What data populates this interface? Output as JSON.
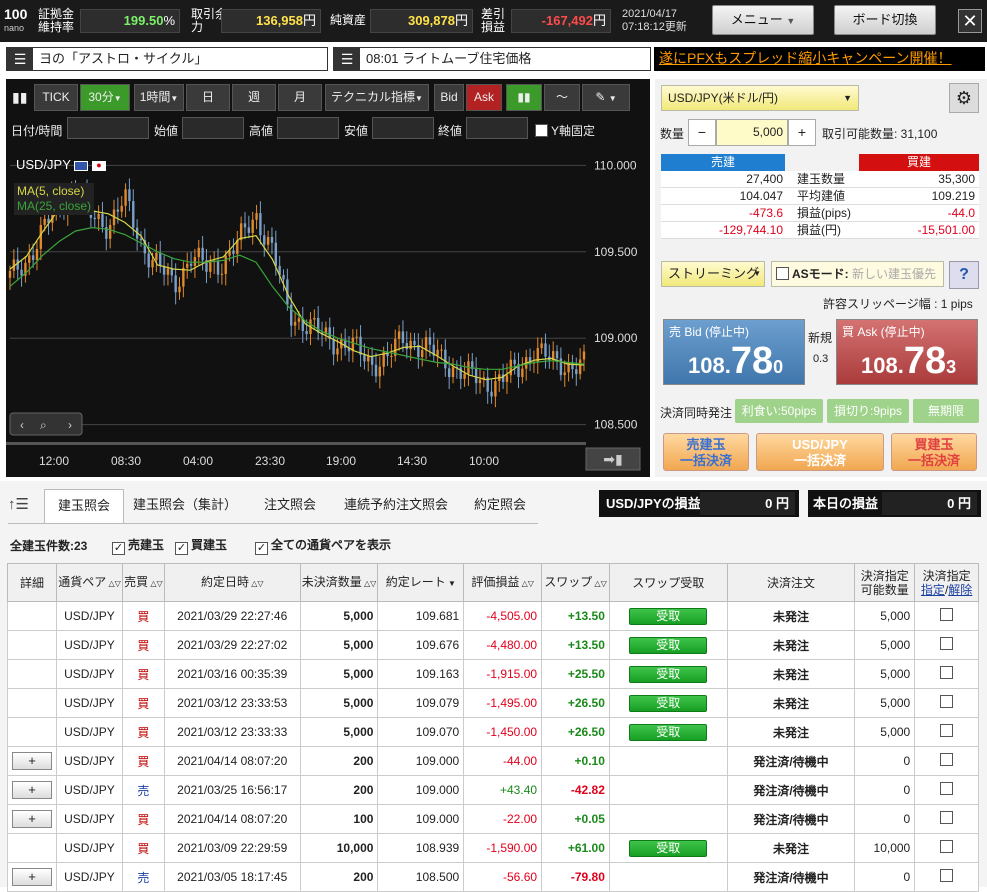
{
  "topbar": {
    "logo_main": "100",
    "logo_sub": "nano",
    "stats": [
      {
        "label": "証拠金維持率",
        "value": "199.50",
        "unit": "%"
      },
      {
        "label": "取引余力",
        "value": "136,958",
        "unit": "円"
      },
      {
        "label": "純資産",
        "value": "309,878",
        "unit": "円"
      },
      {
        "label": "差引損益",
        "value": "-167,492",
        "unit": "円"
      }
    ],
    "updated_date": "2021/04/17",
    "updated_time": "07:18:12更新",
    "menu_label": "メニュー",
    "board_label": "ボード切換",
    "close_label": "✕"
  },
  "news": {
    "item1": "ヨの「アストロ・サイクル」",
    "item2": "08:01 ライトムーブ住宅価格",
    "promo": "遂にPFXもスプレッド縮小キャンペーン開催！"
  },
  "chart_toolbar": {
    "tick": "TICK",
    "m30": "30分",
    "h1": "1時間",
    "day": "日",
    "week": "週",
    "month": "月",
    "tech": "テクニカル指標",
    "bid": "Bid",
    "ask": "Ask"
  },
  "chart_fields": {
    "datetime": "日付/時間",
    "open": "始値",
    "high": "高値",
    "low": "安値",
    "close": "終値",
    "yfix": "Y軸固定"
  },
  "chart_data": {
    "type": "line",
    "pair_label": "USD/JPY",
    "legend": [
      "MA(5, close)",
      "MA(25, close)"
    ],
    "y_ticks": [
      "110.000",
      "109.500",
      "109.000",
      "108.500"
    ],
    "ylim": [
      108.5,
      110.0
    ],
    "x_ticks": [
      "12:00",
      "08:30",
      "04:00",
      "23:30",
      "19:00",
      "14:30",
      "10:00"
    ],
    "price": [
      109.35,
      109.45,
      109.62,
      109.78,
      109.85,
      109.7,
      109.66,
      109.8,
      109.55,
      109.42,
      109.3,
      109.48,
      109.4,
      109.45,
      109.56,
      109.72,
      109.5,
      109.15,
      109.08,
      109.02,
      108.98,
      108.94,
      108.86,
      108.88,
      109.0,
      108.96,
      108.9,
      108.84,
      108.78,
      108.74,
      108.76,
      108.82,
      108.94,
      108.86,
      108.85,
      108.84
    ],
    "ma25": [
      109.3,
      109.38,
      109.48,
      109.56,
      109.62,
      109.64,
      109.63,
      109.6,
      109.55,
      109.5,
      109.46,
      109.44,
      109.44,
      109.45,
      109.48,
      109.44,
      109.3,
      109.18,
      109.1,
      109.04,
      109.0,
      108.97,
      108.94,
      108.92,
      108.9,
      108.88,
      108.86,
      108.85,
      108.83,
      108.82,
      108.82,
      108.84,
      108.86,
      108.87,
      108.86,
      108.85
    ]
  },
  "right": {
    "pair": "USD/JPY(米ドル/円)",
    "qty_label": "数量",
    "qty_value": "5,000",
    "minus": "−",
    "plus": "+",
    "available": "取引可能数量: 31,100",
    "sell_header": "売建",
    "buy_header": "買建",
    "rows": [
      {
        "sell": "27,400",
        "label": "建玉数量",
        "buy": "35,300"
      },
      {
        "sell": "104.047",
        "label": "平均建値",
        "buy": "109.219"
      },
      {
        "sell": "-473.6",
        "label": "損益(pips)",
        "buy": "-44.0"
      },
      {
        "sell": "-129,744.10",
        "label": "損益(円)",
        "buy": "-15,501.00"
      }
    ],
    "streaming": "ストリーミング",
    "as_mode": "ASモード:",
    "as_placeholder": "新しい建玉優先",
    "help": "?",
    "slippage": "許容スリッページ幅 : 1 pips",
    "bid_label": "売 Bid (停止中)",
    "bid_big": "108.",
    "bid_pips": "78",
    "bid_small": "0",
    "new_label": "新規",
    "spread": "0.3",
    "ask_label": "買 Ask (停止中)",
    "ask_big": "108.",
    "ask_pips": "78",
    "ask_small": "3",
    "settle_label": "決済同時発注",
    "take_profit": "利食い:50pips",
    "stop_loss": "損切り:9pips",
    "unlimited": "無期限",
    "btn1a": "売建玉",
    "btn1b": "一括決済",
    "btn2a": "USD/JPY",
    "btn2b": "一括決済",
    "btn3a": "買建玉",
    "btn3b": "一括決済"
  },
  "tabs": [
    "建玉照会",
    "建玉照会（集計）",
    "注文照会",
    "連続予約注文照会",
    "約定照会"
  ],
  "pnl": [
    {
      "label": "USD/JPYの損益",
      "value": "0 円"
    },
    {
      "label": "本日の損益",
      "value": "0 円"
    }
  ],
  "filters": {
    "total": "全建玉件数:23",
    "sell": "売建玉",
    "buy": "買建玉",
    "all": "全ての通貨ペアを表示"
  },
  "table": {
    "headers": [
      "詳細",
      "通貨ペア",
      "売買",
      "約定日時",
      "未決済数量",
      "約定レート",
      "評価損益",
      "スワップ",
      "スワップ受取",
      "決済注文",
      "決済指定可能数量",
      "決済指定"
    ],
    "header_link1": "指定",
    "header_link2": "解除",
    "rows": [
      {
        "detail": "",
        "pair": "USD/JPY",
        "side": "買",
        "date": "2021/03/29 22:27:46",
        "qty": "5,000",
        "rate": "109.681",
        "pnl": "-4,505.00",
        "swap": "+13.50",
        "recv": "受取",
        "order": "未発注",
        "avail": "5,000"
      },
      {
        "detail": "",
        "pair": "USD/JPY",
        "side": "買",
        "date": "2021/03/29 22:27:02",
        "qty": "5,000",
        "rate": "109.676",
        "pnl": "-4,480.00",
        "swap": "+13.50",
        "recv": "受取",
        "order": "未発注",
        "avail": "5,000"
      },
      {
        "detail": "",
        "pair": "USD/JPY",
        "side": "買",
        "date": "2021/03/16 00:35:39",
        "qty": "5,000",
        "rate": "109.163",
        "pnl": "-1,915.00",
        "swap": "+25.50",
        "recv": "受取",
        "order": "未発注",
        "avail": "5,000"
      },
      {
        "detail": "",
        "pair": "USD/JPY",
        "side": "買",
        "date": "2021/03/12 23:33:53",
        "qty": "5,000",
        "rate": "109.079",
        "pnl": "-1,495.00",
        "swap": "+26.50",
        "recv": "受取",
        "order": "未発注",
        "avail": "5,000"
      },
      {
        "detail": "",
        "pair": "USD/JPY",
        "side": "買",
        "date": "2021/03/12 23:33:33",
        "qty": "5,000",
        "rate": "109.070",
        "pnl": "-1,450.00",
        "swap": "+26.50",
        "recv": "受取",
        "order": "未発注",
        "avail": "5,000"
      },
      {
        "detail": "+",
        "pair": "USD/JPY",
        "side": "買",
        "date": "2021/04/14 08:07:20",
        "qty": "200",
        "rate": "109.000",
        "pnl": "-44.00",
        "swap": "+0.10",
        "recv": "",
        "order": "発注済/待機中",
        "avail": "0"
      },
      {
        "detail": "+",
        "pair": "USD/JPY",
        "side": "売",
        "date": "2021/03/25 16:56:17",
        "qty": "200",
        "rate": "109.000",
        "pnl": "+43.40",
        "swap": "-42.82",
        "recv": "",
        "order": "発注済/待機中",
        "avail": "0"
      },
      {
        "detail": "+",
        "pair": "USD/JPY",
        "side": "買",
        "date": "2021/04/14 08:07:20",
        "qty": "100",
        "rate": "109.000",
        "pnl": "-22.00",
        "swap": "+0.05",
        "recv": "",
        "order": "発注済/待機中",
        "avail": "0"
      },
      {
        "detail": "",
        "pair": "USD/JPY",
        "side": "買",
        "date": "2021/03/09 22:29:59",
        "qty": "10,000",
        "rate": "108.939",
        "pnl": "-1,590.00",
        "swap": "+61.00",
        "recv": "受取",
        "order": "未発注",
        "avail": "10,000"
      },
      {
        "detail": "+",
        "pair": "USD/JPY",
        "side": "売",
        "date": "2021/03/05 18:17:45",
        "qty": "200",
        "rate": "108.500",
        "pnl": "-56.60",
        "swap": "-79.80",
        "recv": "",
        "order": "発注済/待機中",
        "avail": "0"
      }
    ]
  },
  "colors": {
    "neg": "#e0001c",
    "pos": "#1a8a1a",
    "bid_bg": "#4f86b8",
    "ask_bg": "#b84a4a",
    "promo": "#ff9900"
  }
}
